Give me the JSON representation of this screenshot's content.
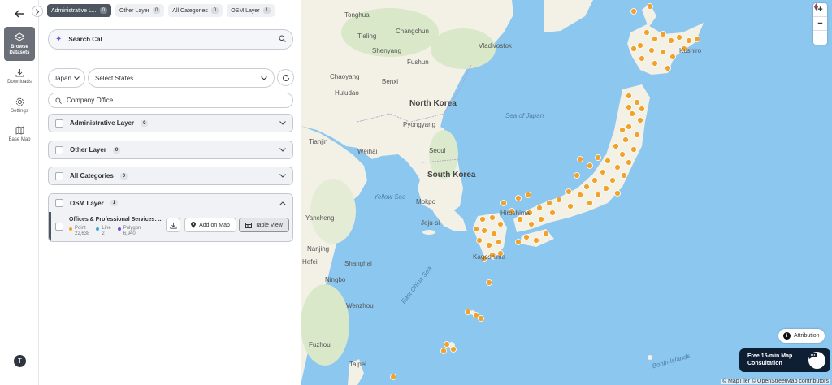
{
  "rail": {
    "back_icon": "arrow-left-icon",
    "items": [
      {
        "label": "Browse Datasets",
        "icon": "layers-icon",
        "active": true
      },
      {
        "label": "Downloads",
        "icon": "download-icon"
      },
      {
        "label": "Settings",
        "icon": "gear-icon"
      },
      {
        "label": "Base Map",
        "icon": "map-icon"
      }
    ],
    "avatar": "T"
  },
  "chips": [
    {
      "label": "Administrative L...",
      "count": "0"
    },
    {
      "label": "Other Layer",
      "count": "0"
    },
    {
      "label": "All Categories",
      "count": "0"
    },
    {
      "label": "OSM Layer",
      "count": "1"
    }
  ],
  "search": {
    "value": "Search Cal"
  },
  "country": {
    "value": "Japan"
  },
  "states": {
    "value": "Select States"
  },
  "filter": {
    "value": "Company Office"
  },
  "layers": [
    {
      "label": "Administrative Layer",
      "count": "0"
    },
    {
      "label": "Other Layer",
      "count": "0"
    },
    {
      "label": "All Categories",
      "count": "0"
    }
  ],
  "osm": {
    "label": "OSM Layer",
    "count": "1",
    "dataset": {
      "title": "Offices & Professional Services: ...",
      "point_label": "Point",
      "point_value": "22,638",
      "line_label": "Line",
      "line_value": "2",
      "polygon_label": "Polygon",
      "polygon_value": "6,940",
      "add_label": "Add on Map",
      "table_label": "Table View"
    }
  },
  "map": {
    "labels": {
      "tonghua": "Tonghua",
      "changchun": "Changchun",
      "tieling": "Tieling",
      "shenyang": "Shenyang",
      "fushun": "Fushun",
      "vladivostok": "Vladivostok",
      "chaoyang": "Chaoyang",
      "benxi": "Benxi",
      "huludao": "Huludao",
      "north_korea": "North Korea",
      "pyongyang": "Pyongyang",
      "sea_of_japan": "Sea of Japan",
      "tianjin": "Tianjin",
      "weihai": "Weihai",
      "seoul": "Seoul",
      "south_korea": "South Korea",
      "yellow_sea": "Yellow Sea",
      "mokpo": "Mokpo",
      "jeju": "Jeju-si",
      "yancheng": "Yancheng",
      "nanjing": "Nanjing",
      "shanghai": "Shanghai",
      "hefei": "Hefei",
      "ningbo": "Ningbo",
      "wenzhou": "Wenzhou",
      "fuzhou": "Fuzhou",
      "taipei": "Taipei",
      "east_china_sea": "East China Sea",
      "kushiro": "Kushiro",
      "hiroshima": "Hiroshima",
      "kagoshima": "Kagoshima",
      "bonin": "Bonin Islands"
    },
    "zoom_in": "+",
    "zoom_out": "−",
    "attribution": "Attribution",
    "consult_line1": "Free 15-min Map",
    "consult_line2": "Consultation",
    "copyright": "© MapTiler © OpenStreetMap contributors",
    "colors": {
      "sea": "#8cc7ef",
      "land": "#f3f0e6",
      "marker": "#f0a22a"
    }
  }
}
